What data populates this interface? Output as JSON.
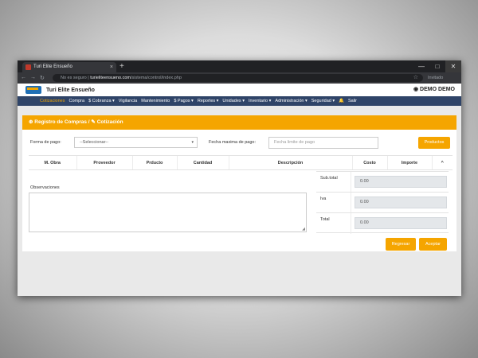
{
  "browser": {
    "tab_title": "Turi Elite Ensueño",
    "tab_close": "×",
    "new_tab": "+",
    "url_secure": "No es seguro",
    "url_host": "turieliteensueno.com",
    "url_path": "/sistema/control/index.php",
    "profile_label": "Invitado",
    "window_buttons": [
      "—",
      "□",
      "✕"
    ],
    "nav_glyphs": [
      "←",
      "→",
      "↻"
    ]
  },
  "app": {
    "brand": "Turi Elite Ensueño",
    "user": "DEMO DEMO"
  },
  "navbar": {
    "items": [
      {
        "label": "Cotizaciones",
        "active": true
      },
      {
        "label": "Compra",
        "active": false
      },
      {
        "label": "$ Cobranza ▾",
        "active": false
      },
      {
        "label": "Vigilancia",
        "active": false
      },
      {
        "label": "Mantenimiento",
        "active": false
      },
      {
        "label": "$ Pagos ▾",
        "active": false
      },
      {
        "label": "Reportes ▾",
        "active": false
      },
      {
        "label": "Unidades ▾",
        "active": false
      },
      {
        "label": "Inventario ▾",
        "active": false
      },
      {
        "label": "Administración ▾",
        "active": false
      },
      {
        "label": "Seguridad ▾",
        "active": false
      },
      {
        "label": "🔔",
        "active": false
      },
      {
        "label": "Salir",
        "active": false
      }
    ]
  },
  "panel": {
    "title": "Registro de Compras / ",
    "title_current": "Cotización",
    "forma_pago_label": "Forma de pago:",
    "forma_pago_value": "--Seleccionar--",
    "fecha_label": "Fecha maxima de pago:",
    "fecha_placeholder": "Fecha limite de pago",
    "productos_button": "Productos",
    "table_headers": [
      "M. Obra",
      "Proveedor",
      "Prducto",
      "Cantidad",
      "Descripción",
      "Costo",
      "Importe",
      "^"
    ],
    "observaciones_label": "Observaciones",
    "totals": [
      {
        "label": "Sub.total",
        "value": "0.00"
      },
      {
        "label": "Iva",
        "value": "0.00"
      },
      {
        "label": "Total",
        "value": "0.00"
      }
    ],
    "regresar_button": "Regresar",
    "aceptar_button": "Aceptar"
  },
  "colors": {
    "accent": "#f5a500",
    "navbar": "#2f4468"
  }
}
